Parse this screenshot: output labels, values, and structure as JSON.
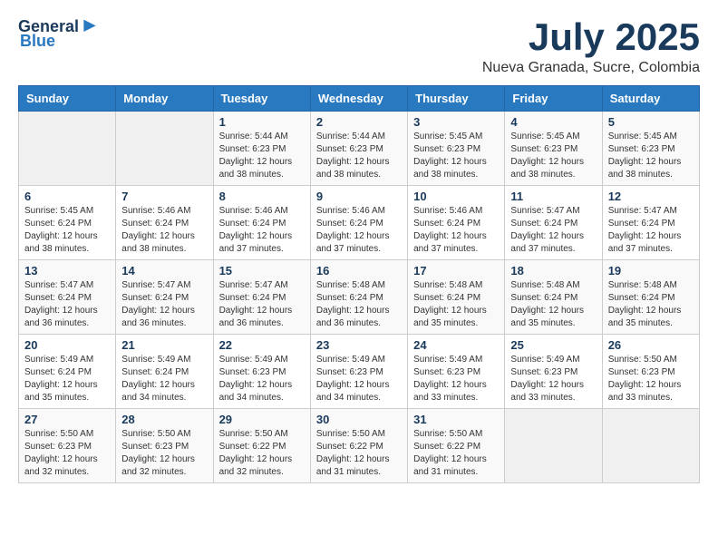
{
  "header": {
    "logo_general": "General",
    "logo_blue": "Blue",
    "title": "July 2025",
    "subtitle": "Nueva Granada, Sucre, Colombia"
  },
  "calendar": {
    "days_of_week": [
      "Sunday",
      "Monday",
      "Tuesday",
      "Wednesday",
      "Thursday",
      "Friday",
      "Saturday"
    ],
    "weeks": [
      [
        {
          "day": "",
          "info": ""
        },
        {
          "day": "",
          "info": ""
        },
        {
          "day": "1",
          "info": "Sunrise: 5:44 AM\nSunset: 6:23 PM\nDaylight: 12 hours and 38 minutes."
        },
        {
          "day": "2",
          "info": "Sunrise: 5:44 AM\nSunset: 6:23 PM\nDaylight: 12 hours and 38 minutes."
        },
        {
          "day": "3",
          "info": "Sunrise: 5:45 AM\nSunset: 6:23 PM\nDaylight: 12 hours and 38 minutes."
        },
        {
          "day": "4",
          "info": "Sunrise: 5:45 AM\nSunset: 6:23 PM\nDaylight: 12 hours and 38 minutes."
        },
        {
          "day": "5",
          "info": "Sunrise: 5:45 AM\nSunset: 6:23 PM\nDaylight: 12 hours and 38 minutes."
        }
      ],
      [
        {
          "day": "6",
          "info": "Sunrise: 5:45 AM\nSunset: 6:24 PM\nDaylight: 12 hours and 38 minutes."
        },
        {
          "day": "7",
          "info": "Sunrise: 5:46 AM\nSunset: 6:24 PM\nDaylight: 12 hours and 38 minutes."
        },
        {
          "day": "8",
          "info": "Sunrise: 5:46 AM\nSunset: 6:24 PM\nDaylight: 12 hours and 37 minutes."
        },
        {
          "day": "9",
          "info": "Sunrise: 5:46 AM\nSunset: 6:24 PM\nDaylight: 12 hours and 37 minutes."
        },
        {
          "day": "10",
          "info": "Sunrise: 5:46 AM\nSunset: 6:24 PM\nDaylight: 12 hours and 37 minutes."
        },
        {
          "day": "11",
          "info": "Sunrise: 5:47 AM\nSunset: 6:24 PM\nDaylight: 12 hours and 37 minutes."
        },
        {
          "day": "12",
          "info": "Sunrise: 5:47 AM\nSunset: 6:24 PM\nDaylight: 12 hours and 37 minutes."
        }
      ],
      [
        {
          "day": "13",
          "info": "Sunrise: 5:47 AM\nSunset: 6:24 PM\nDaylight: 12 hours and 36 minutes."
        },
        {
          "day": "14",
          "info": "Sunrise: 5:47 AM\nSunset: 6:24 PM\nDaylight: 12 hours and 36 minutes."
        },
        {
          "day": "15",
          "info": "Sunrise: 5:47 AM\nSunset: 6:24 PM\nDaylight: 12 hours and 36 minutes."
        },
        {
          "day": "16",
          "info": "Sunrise: 5:48 AM\nSunset: 6:24 PM\nDaylight: 12 hours and 36 minutes."
        },
        {
          "day": "17",
          "info": "Sunrise: 5:48 AM\nSunset: 6:24 PM\nDaylight: 12 hours and 35 minutes."
        },
        {
          "day": "18",
          "info": "Sunrise: 5:48 AM\nSunset: 6:24 PM\nDaylight: 12 hours and 35 minutes."
        },
        {
          "day": "19",
          "info": "Sunrise: 5:48 AM\nSunset: 6:24 PM\nDaylight: 12 hours and 35 minutes."
        }
      ],
      [
        {
          "day": "20",
          "info": "Sunrise: 5:49 AM\nSunset: 6:24 PM\nDaylight: 12 hours and 35 minutes."
        },
        {
          "day": "21",
          "info": "Sunrise: 5:49 AM\nSunset: 6:24 PM\nDaylight: 12 hours and 34 minutes."
        },
        {
          "day": "22",
          "info": "Sunrise: 5:49 AM\nSunset: 6:23 PM\nDaylight: 12 hours and 34 minutes."
        },
        {
          "day": "23",
          "info": "Sunrise: 5:49 AM\nSunset: 6:23 PM\nDaylight: 12 hours and 34 minutes."
        },
        {
          "day": "24",
          "info": "Sunrise: 5:49 AM\nSunset: 6:23 PM\nDaylight: 12 hours and 33 minutes."
        },
        {
          "day": "25",
          "info": "Sunrise: 5:49 AM\nSunset: 6:23 PM\nDaylight: 12 hours and 33 minutes."
        },
        {
          "day": "26",
          "info": "Sunrise: 5:50 AM\nSunset: 6:23 PM\nDaylight: 12 hours and 33 minutes."
        }
      ],
      [
        {
          "day": "27",
          "info": "Sunrise: 5:50 AM\nSunset: 6:23 PM\nDaylight: 12 hours and 32 minutes."
        },
        {
          "day": "28",
          "info": "Sunrise: 5:50 AM\nSunset: 6:23 PM\nDaylight: 12 hours and 32 minutes."
        },
        {
          "day": "29",
          "info": "Sunrise: 5:50 AM\nSunset: 6:22 PM\nDaylight: 12 hours and 32 minutes."
        },
        {
          "day": "30",
          "info": "Sunrise: 5:50 AM\nSunset: 6:22 PM\nDaylight: 12 hours and 31 minutes."
        },
        {
          "day": "31",
          "info": "Sunrise: 5:50 AM\nSunset: 6:22 PM\nDaylight: 12 hours and 31 minutes."
        },
        {
          "day": "",
          "info": ""
        },
        {
          "day": "",
          "info": ""
        }
      ]
    ]
  }
}
